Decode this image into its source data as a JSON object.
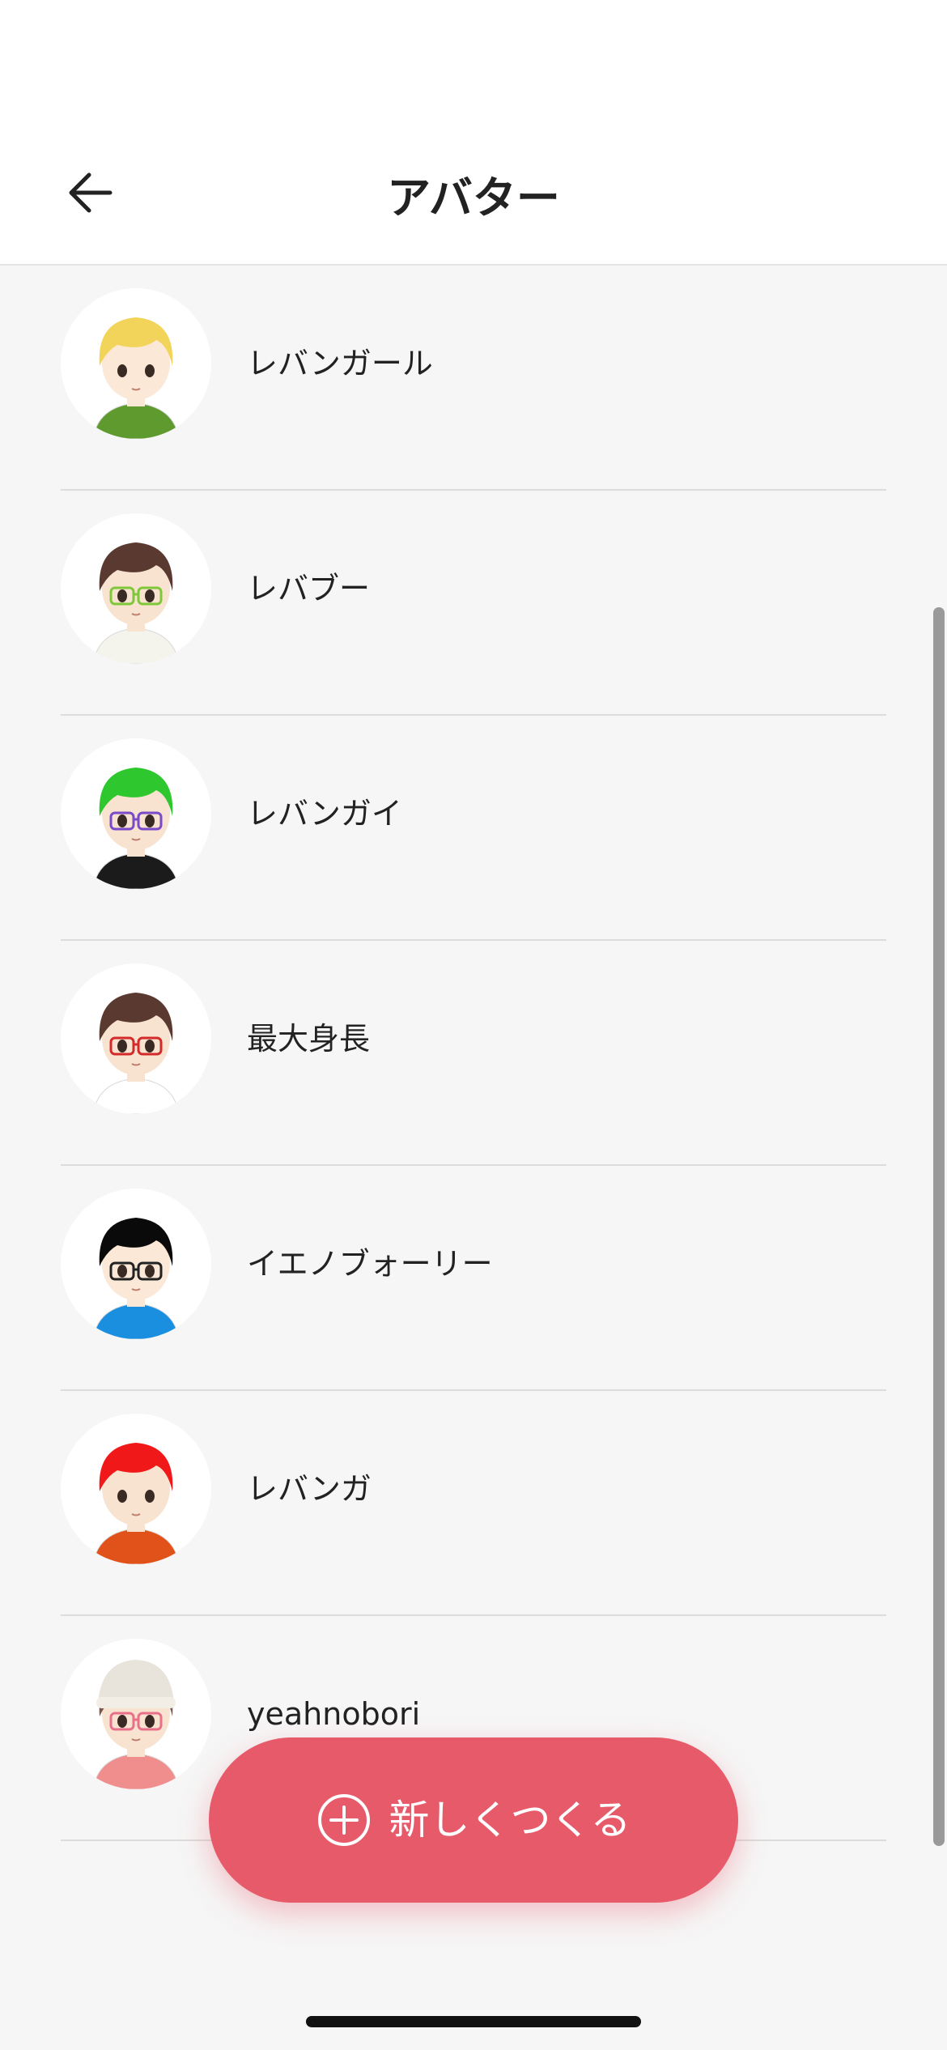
{
  "header": {
    "title": "アバター",
    "back_icon": "arrow-left-icon"
  },
  "avatars": [
    {
      "name": "レバンガール",
      "hair": "#f2d45a",
      "skin": "#fbe8d6",
      "shirt": "#5e9a2e",
      "glasses": null
    },
    {
      "name": "レバブー",
      "hair": "#5a3a30",
      "skin": "#f7e3d0",
      "shirt": "#f4f4ec",
      "glasses": "#7ec83a"
    },
    {
      "name": "レバンガイ",
      "hair": "#2ec82e",
      "skin": "#f7e3d0",
      "shirt": "#1b1b1b",
      "glasses": "#7a4ac8"
    },
    {
      "name": "最大身長",
      "hair": "#5a3a30",
      "skin": "#f7e3d0",
      "shirt": "#ffffff",
      "glasses": "#d42a2a"
    },
    {
      "name": "イエノブォーリー",
      "hair": "#0a0a0a",
      "skin": "#fbe8d6",
      "shirt": "#1a8fe0",
      "glasses": "#222222"
    },
    {
      "name": "レバンガ",
      "hair": "#f01818",
      "skin": "#f7e3d0",
      "shirt": "#e0521a",
      "glasses": null
    },
    {
      "name": "yeahnobori",
      "hair": "#7a5650",
      "skin": "#f7e3d0",
      "shirt": "#f08e8e",
      "glasses": "#e8708a",
      "hat": "#e8e4dc"
    }
  ],
  "fab": {
    "label": "新しくつくる",
    "icon": "plus-circle-icon"
  },
  "colors": {
    "accent": "#e75a6a",
    "background": "#f6f6f6"
  }
}
